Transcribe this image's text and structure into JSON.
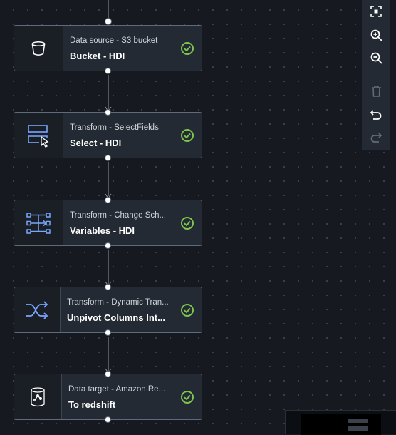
{
  "nodes": [
    {
      "subtitle": "Data source - S3 bucket",
      "title": "Bucket - HDI",
      "icon": "bucket-icon",
      "status": "success"
    },
    {
      "subtitle": "Transform - SelectFields",
      "title": "Select - HDI",
      "icon": "select-fields-icon",
      "status": "success"
    },
    {
      "subtitle": "Transform - Change Sch...",
      "title": "Variables - HDI",
      "icon": "change-schema-icon",
      "status": "success"
    },
    {
      "subtitle": "Transform - Dynamic Tran...",
      "title": "Unpivot Columns Int...",
      "icon": "shuffle-icon",
      "status": "success"
    },
    {
      "subtitle": "Data target - Amazon Re...",
      "title": "To redshift",
      "icon": "redshift-database-icon",
      "status": "success"
    }
  ],
  "toolbar": {
    "tools": [
      {
        "name": "fit-view",
        "icon": "fit-view-icon",
        "enabled": true
      },
      {
        "name": "zoom-in",
        "icon": "zoom-in-icon",
        "enabled": true
      },
      {
        "name": "zoom-out",
        "icon": "zoom-out-icon",
        "enabled": true
      },
      {
        "name": "delete",
        "icon": "trash-icon",
        "enabled": false
      },
      {
        "name": "undo",
        "icon": "undo-icon",
        "enabled": true
      },
      {
        "name": "redo",
        "icon": "redo-icon",
        "enabled": false
      }
    ]
  },
  "colors": {
    "canvas": "#16191f",
    "node_bg": "#232a33",
    "node_border": "#5f6b7a",
    "accent_blue": "#7aa6ff",
    "success_green": "#7ec44f",
    "edge": "#8d99a8"
  }
}
